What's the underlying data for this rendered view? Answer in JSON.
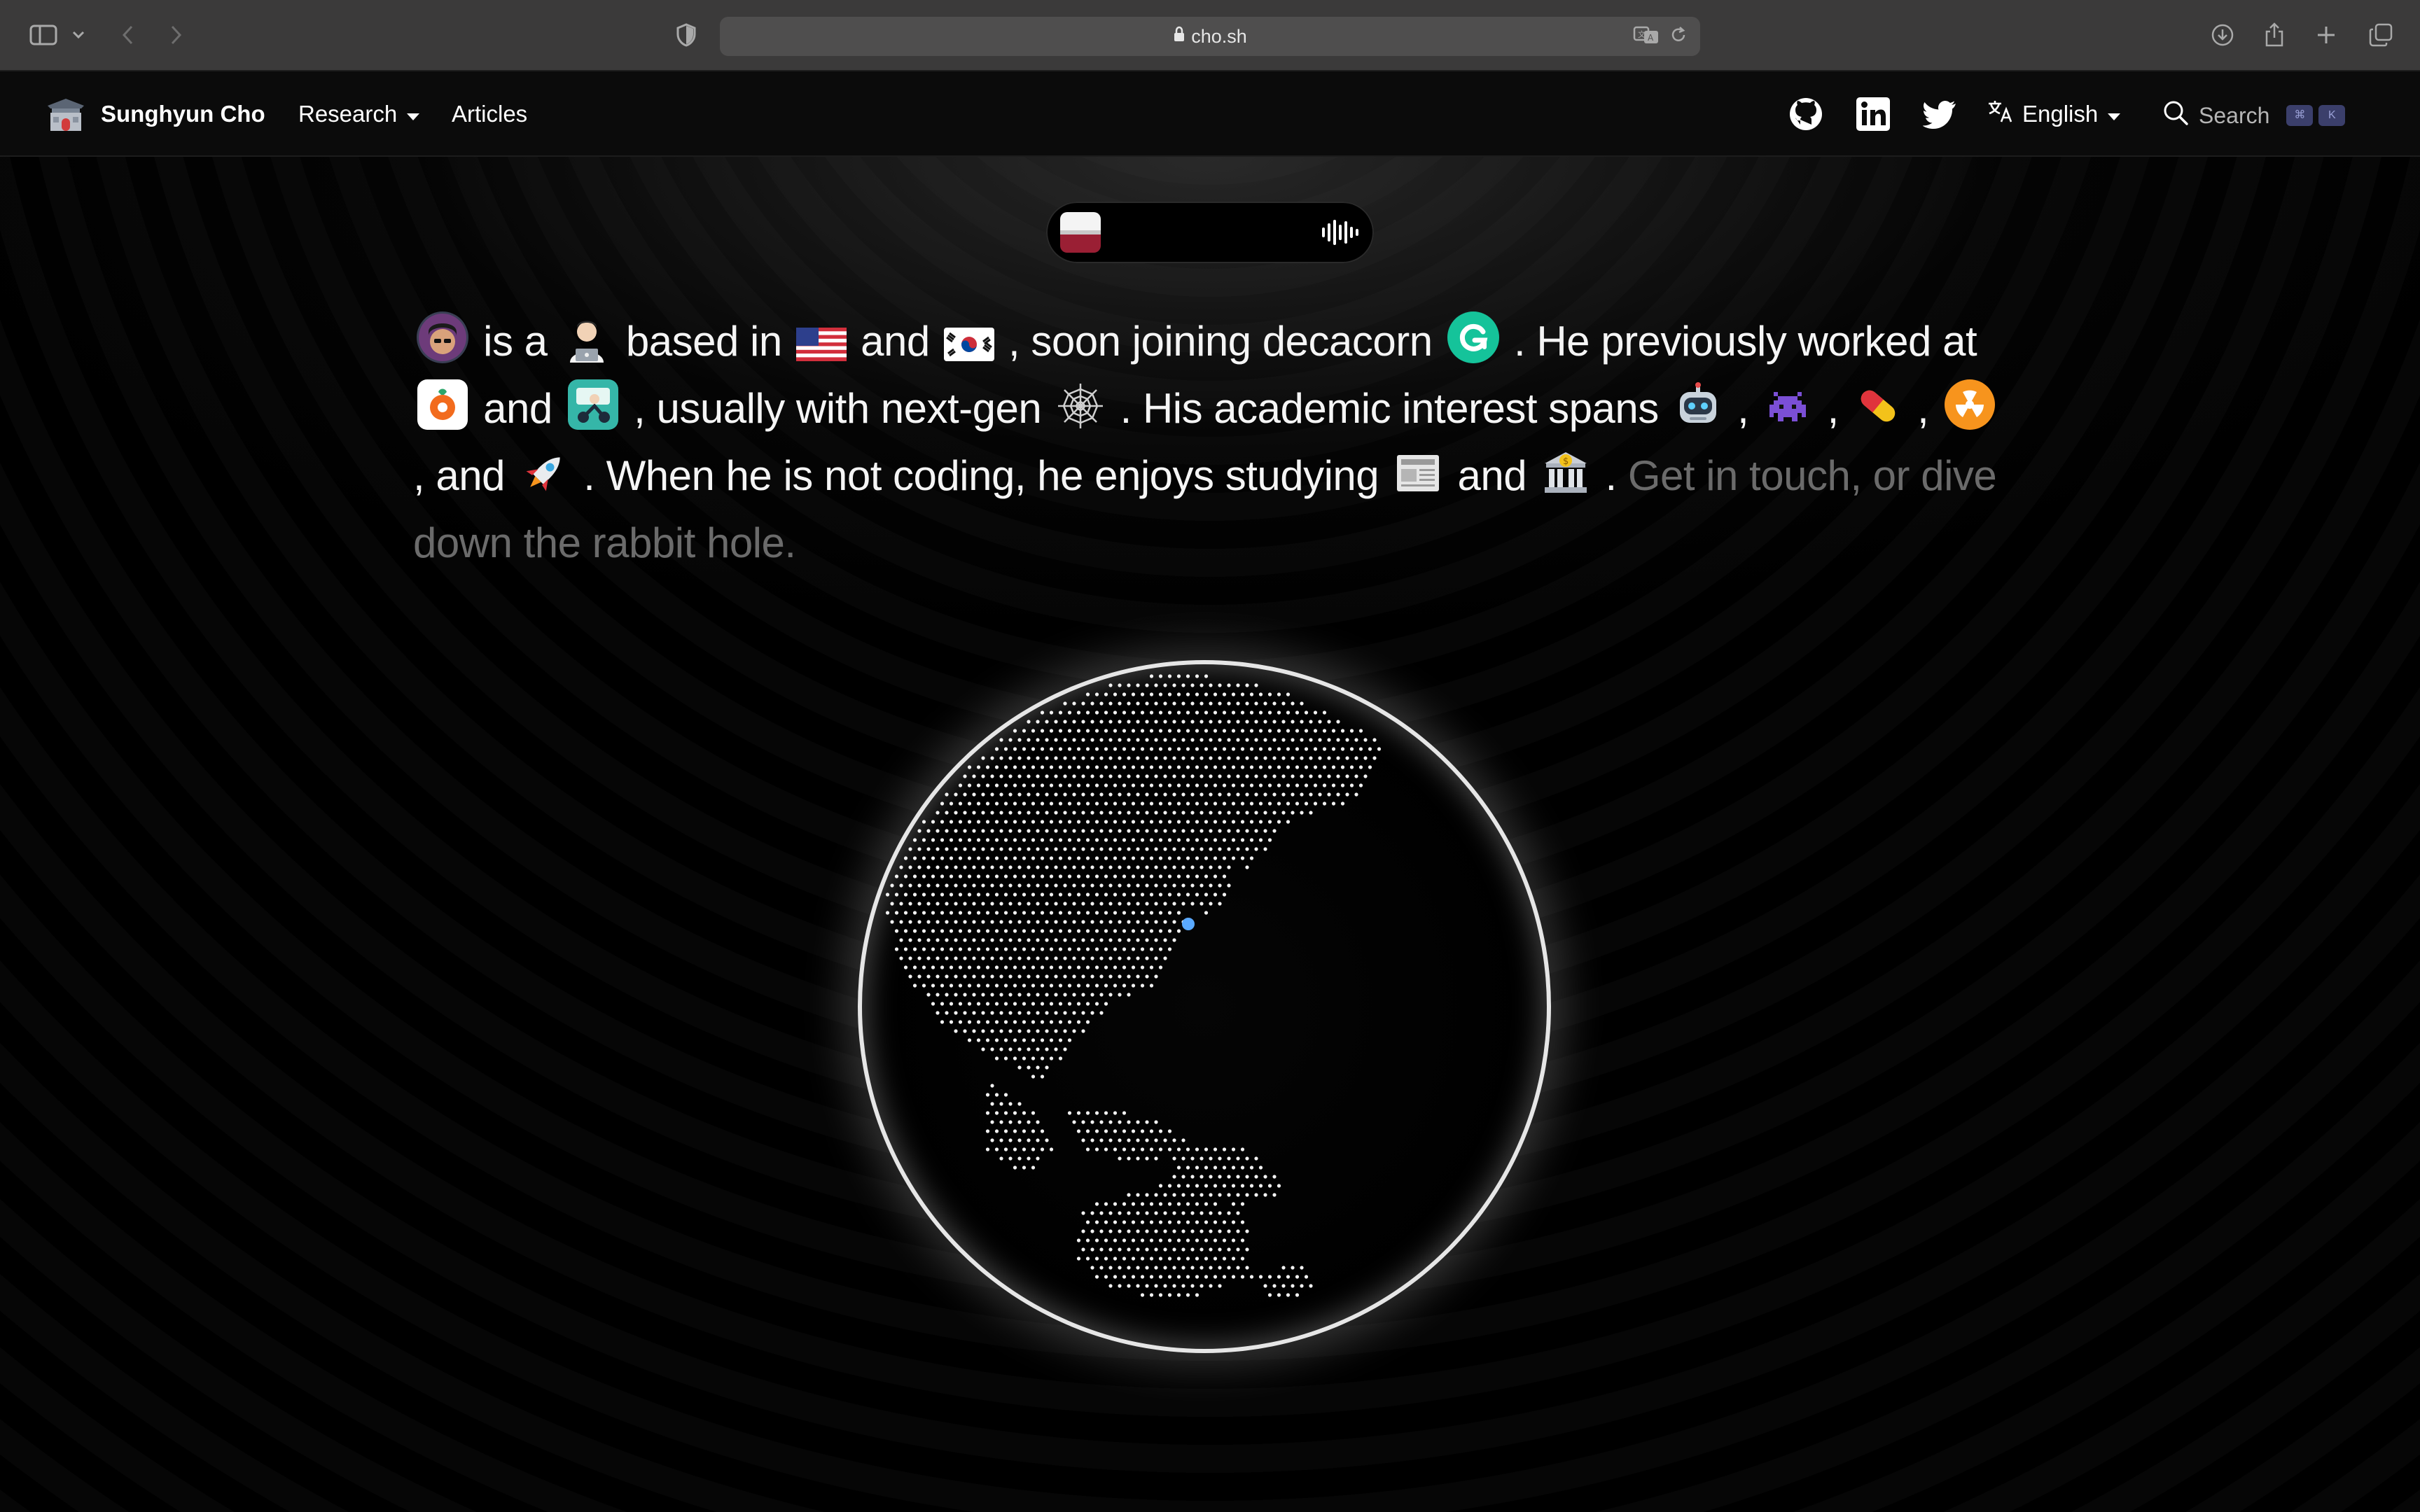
{
  "browser": {
    "url": "cho.sh"
  },
  "nav": {
    "brand": "Sunghyun Cho",
    "research": "Research",
    "articles": "Articles",
    "language": "English",
    "search_label": "Search",
    "kbd_cmd": "⌘",
    "kbd_k": "K"
  },
  "bio": {
    "t1": "is a",
    "t2": "based in",
    "t3": "and",
    "t4": ", soon joining decacorn",
    "t5": ". He previously worked at",
    "t6": "and",
    "t7": ", usually with next-gen",
    "t8": ". His academic interest spans",
    "t9": ",",
    "t10": ",",
    "t11": ",",
    "t12": ",",
    "t13": "and",
    "t14": ". When he is not coding, he enjoys studying",
    "t15": "and",
    "t16": ".",
    "cta": "Get in touch, or dive down the rabbit hole."
  },
  "colors": {
    "accent_dot": "#5aa9ff",
    "grammarly": "#15c39a",
    "orange_app": "#f26b1d"
  }
}
